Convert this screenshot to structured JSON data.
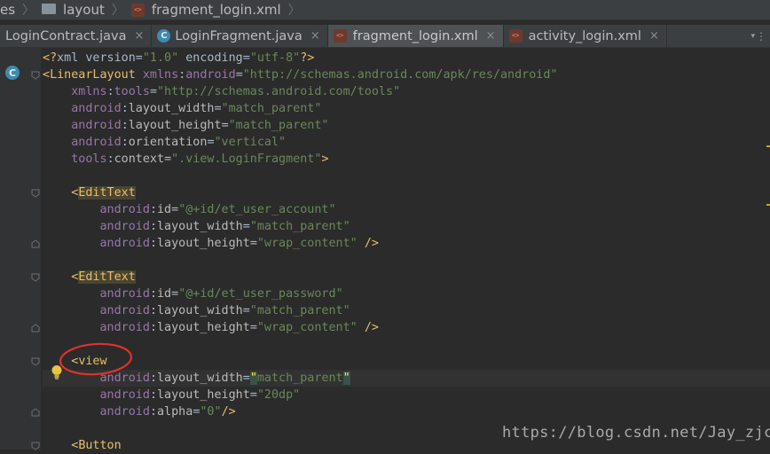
{
  "breadcrumb": {
    "items": [
      "es",
      "layout",
      "fragment_login.xml"
    ]
  },
  "tabs": [
    {
      "label": "LoginContract.java",
      "icon": "java-class-icon",
      "active": false
    },
    {
      "label": "LoginFragment.java",
      "icon": "java-class-icon",
      "active": false
    },
    {
      "label": "fragment_login.xml",
      "icon": "xml-file-icon",
      "active": true
    },
    {
      "label": "activity_login.xml",
      "icon": "xml-file-icon",
      "active": false
    }
  ],
  "tab_close_glyph": "×",
  "tab_overflow_glyph": "⋮",
  "class_marker": "C",
  "code_lines": [
    [
      [
        "t-br",
        "<?"
      ],
      [
        "t-plain",
        "xml version="
      ],
      [
        "t-str",
        "\"1.0\""
      ],
      [
        "t-plain",
        " encoding="
      ],
      [
        "t-str",
        "\"utf-8\""
      ],
      [
        "t-br",
        "?>"
      ]
    ],
    [
      [
        "t-br",
        "<"
      ],
      [
        "t-tag",
        "LinearLayout "
      ],
      [
        "t-ns",
        "xmlns"
      ],
      [
        "t-plain",
        ":"
      ],
      [
        "t-ns",
        "android"
      ],
      [
        "t-plain",
        "="
      ],
      [
        "t-str",
        "\"http://schemas.android.com/apk/res/android\""
      ]
    ],
    [
      [
        "t-plain",
        "    "
      ],
      [
        "t-ns",
        "xmlns"
      ],
      [
        "t-plain",
        ":"
      ],
      [
        "t-ns",
        "tools"
      ],
      [
        "t-plain",
        "="
      ],
      [
        "t-str",
        "\"http://schemas.android.com/tools\""
      ]
    ],
    [
      [
        "t-plain",
        "    "
      ],
      [
        "t-ns",
        "android"
      ],
      [
        "t-plain",
        ":"
      ],
      [
        "t-attr",
        "layout_width"
      ],
      [
        "t-plain",
        "="
      ],
      [
        "t-str",
        "\"match_parent\""
      ]
    ],
    [
      [
        "t-plain",
        "    "
      ],
      [
        "t-ns",
        "android"
      ],
      [
        "t-plain",
        ":"
      ],
      [
        "t-attr",
        "layout_height"
      ],
      [
        "t-plain",
        "="
      ],
      [
        "t-str",
        "\"match_parent\""
      ]
    ],
    [
      [
        "t-plain",
        "    "
      ],
      [
        "t-ns",
        "android"
      ],
      [
        "t-plain",
        ":"
      ],
      [
        "t-attr",
        "orientation"
      ],
      [
        "t-plain",
        "="
      ],
      [
        "t-str",
        "\"vertical\""
      ]
    ],
    [
      [
        "t-plain",
        "    "
      ],
      [
        "t-ns",
        "tools"
      ],
      [
        "t-plain",
        ":"
      ],
      [
        "t-attr",
        "context"
      ],
      [
        "t-plain",
        "="
      ],
      [
        "t-str",
        "\".view.LoginFragment\""
      ],
      [
        "t-br",
        ">"
      ]
    ],
    [],
    [
      [
        "t-plain",
        "    "
      ],
      [
        "t-br",
        "<"
      ],
      [
        "t-tag-hl",
        "EditText"
      ]
    ],
    [
      [
        "t-plain",
        "        "
      ],
      [
        "t-ns",
        "android"
      ],
      [
        "t-plain",
        ":"
      ],
      [
        "t-attr",
        "id"
      ],
      [
        "t-plain",
        "="
      ],
      [
        "t-str",
        "\"@+id/et_user_account\""
      ]
    ],
    [
      [
        "t-plain",
        "        "
      ],
      [
        "t-ns",
        "android"
      ],
      [
        "t-plain",
        ":"
      ],
      [
        "t-attr",
        "layout_width"
      ],
      [
        "t-plain",
        "="
      ],
      [
        "t-str",
        "\"match_parent\""
      ]
    ],
    [
      [
        "t-plain",
        "        "
      ],
      [
        "t-ns",
        "android"
      ],
      [
        "t-plain",
        ":"
      ],
      [
        "t-attr",
        "layout_height"
      ],
      [
        "t-plain",
        "="
      ],
      [
        "t-str",
        "\"wrap_content\""
      ],
      [
        "t-plain",
        " "
      ],
      [
        "t-br",
        "/>"
      ]
    ],
    [],
    [
      [
        "t-plain",
        "    "
      ],
      [
        "t-br",
        "<"
      ],
      [
        "t-tag-hl",
        "EditText"
      ]
    ],
    [
      [
        "t-plain",
        "        "
      ],
      [
        "t-ns",
        "android"
      ],
      [
        "t-plain",
        ":"
      ],
      [
        "t-attr",
        "id"
      ],
      [
        "t-plain",
        "="
      ],
      [
        "t-str",
        "\"@+id/et_user_password\""
      ]
    ],
    [
      [
        "t-plain",
        "        "
      ],
      [
        "t-ns",
        "android"
      ],
      [
        "t-plain",
        ":"
      ],
      [
        "t-attr",
        "layout_width"
      ],
      [
        "t-plain",
        "="
      ],
      [
        "t-str",
        "\"match_parent\""
      ]
    ],
    [
      [
        "t-plain",
        "        "
      ],
      [
        "t-ns",
        "android"
      ],
      [
        "t-plain",
        ":"
      ],
      [
        "t-attr",
        "layout_height"
      ],
      [
        "t-plain",
        "="
      ],
      [
        "t-str",
        "\"wrap_content\""
      ],
      [
        "t-plain",
        " "
      ],
      [
        "t-br",
        "/>"
      ]
    ],
    [],
    [
      [
        "t-plain",
        "    "
      ],
      [
        "t-br",
        "<"
      ],
      [
        "t-tag",
        "view"
      ]
    ],
    [
      [
        "t-plain",
        "        "
      ],
      [
        "t-ns",
        "android"
      ],
      [
        "t-plain",
        ":"
      ],
      [
        "t-attr",
        "layout_width"
      ],
      [
        "t-plain",
        "="
      ],
      [
        "caret-q",
        "\""
      ],
      [
        "t-str",
        "match_parent"
      ],
      [
        "caret-q",
        "\""
      ]
    ],
    [
      [
        "t-plain",
        "        "
      ],
      [
        "t-ns",
        "android"
      ],
      [
        "t-plain",
        ":"
      ],
      [
        "t-attr",
        "layout_height"
      ],
      [
        "t-plain",
        "="
      ],
      [
        "t-str",
        "\"20dp\""
      ]
    ],
    [
      [
        "t-plain",
        "        "
      ],
      [
        "t-ns",
        "android"
      ],
      [
        "t-plain",
        ":"
      ],
      [
        "t-attr",
        "alpha"
      ],
      [
        "t-plain",
        "="
      ],
      [
        "t-str",
        "\"0\""
      ],
      [
        "t-br",
        "/>"
      ]
    ],
    [],
    [
      [
        "t-plain",
        "    "
      ],
      [
        "t-br",
        "<"
      ],
      [
        "t-tag",
        "Button"
      ]
    ]
  ],
  "highlighted_line": 19,
  "watermark": "https://blog.csdn.net/Jay_zjc",
  "colors": {
    "editor_bg": "#2b2b2b",
    "gutter_bg": "#313335",
    "tag": "#e8bf6a",
    "namespace": "#9876aa",
    "string": "#6a8759",
    "annotation_circle": "#e0322a"
  }
}
